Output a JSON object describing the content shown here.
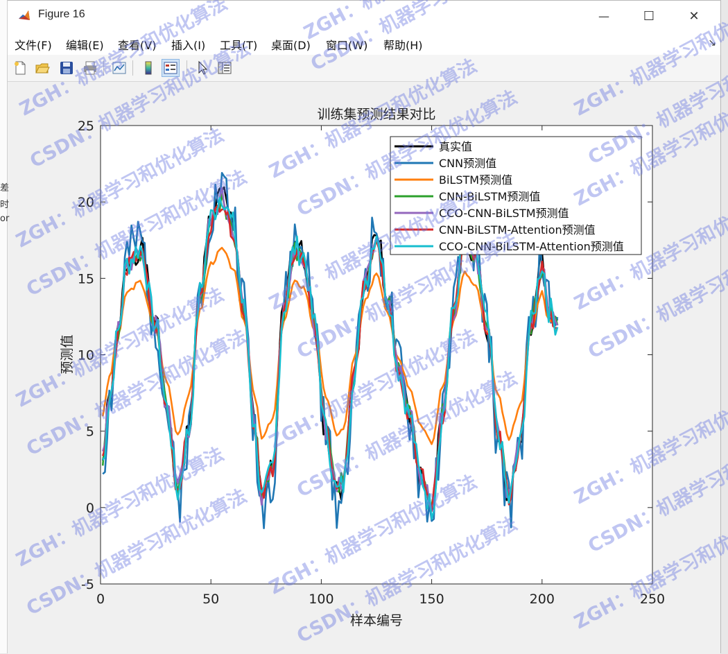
{
  "window": {
    "title": "Figure 16",
    "minimize_label": "—",
    "maximize_label": "☐",
    "close_label": "✕"
  },
  "menu": {
    "items": [
      {
        "label": "文件(F)"
      },
      {
        "label": "编辑(E)"
      },
      {
        "label": "查看(V)"
      },
      {
        "label": "插入(I)"
      },
      {
        "label": "工具(T)"
      },
      {
        "label": "桌面(D)"
      },
      {
        "label": "窗口(W)"
      },
      {
        "label": "帮助(H)"
      }
    ],
    "overflow_arrow": "↘"
  },
  "toolbar": {
    "buttons": [
      {
        "name": "new-figure-icon"
      },
      {
        "name": "open-file-icon"
      },
      {
        "name": "save-icon"
      },
      {
        "name": "print-icon"
      },
      {
        "name": "link-plot-icon"
      },
      {
        "name": "insert-colorbar-icon"
      },
      {
        "name": "insert-legend-icon"
      },
      {
        "name": "pointer-icon"
      },
      {
        "name": "property-inspector-icon"
      }
    ]
  },
  "left_fragments": [
    "差",
    "时",
    "or"
  ],
  "watermark_texts": [
    "ZGH：机器学习和优化算法",
    "CSDN：机器学习和优化算法"
  ],
  "chart_data": {
    "type": "line",
    "title": "训练集预测结果对比",
    "xlabel": "样本编号",
    "ylabel": "预测值",
    "xlim": [
      0,
      250
    ],
    "ylim": [
      -5,
      25
    ],
    "xticks": [
      0,
      50,
      100,
      150,
      200,
      250
    ],
    "yticks": [
      -5,
      0,
      5,
      10,
      15,
      20,
      25
    ],
    "legend_position": "top-right",
    "series": [
      {
        "name": "真实值",
        "color": "#000000",
        "width": 2.6,
        "seed": 1,
        "noise": 0.9,
        "amp": 1.0,
        "off": 0.0
      },
      {
        "name": "CNN预测值",
        "color": "#1f77b4",
        "width": 2.6,
        "seed": 2,
        "noise": 1.9,
        "amp": 1.05,
        "off": 0.0
      },
      {
        "name": "BiLSTM预测值",
        "color": "#ff7f0e",
        "width": 2.6,
        "seed": 3,
        "noise": 0.15,
        "amp": 0.62,
        "off": 0.4
      },
      {
        "name": "CNN-BiLSTM预测值",
        "color": "#2ca02c",
        "width": 2.6,
        "seed": 4,
        "noise": 0.6,
        "amp": 0.96,
        "off": 0.0
      },
      {
        "name": "CCO-CNN-BiLSTM预测值",
        "color": "#9467bd",
        "width": 2.6,
        "seed": 5,
        "noise": 0.7,
        "amp": 0.98,
        "off": 0.0
      },
      {
        "name": "CNN-BiLSTM-Attention预测值",
        "color": "#d62728",
        "width": 2.6,
        "seed": 6,
        "noise": 0.6,
        "amp": 0.97,
        "off": -0.1
      },
      {
        "name": "CCO-CNN-BiLSTM-Attention预测值",
        "color": "#17becf",
        "width": 2.6,
        "seed": 7,
        "noise": 0.9,
        "amp": 1.0,
        "off": 0.0
      }
    ],
    "base_curve": {
      "x": [
        1,
        4,
        8,
        12,
        18,
        25,
        30,
        35,
        40,
        45,
        50,
        55,
        60,
        65,
        70,
        73,
        78,
        83,
        88,
        92,
        97,
        102,
        107,
        110,
        115,
        120,
        125,
        130,
        135,
        140,
        145,
        150,
        155,
        160,
        165,
        170,
        175,
        180,
        185,
        190,
        195,
        200,
        203,
        207
      ],
      "y": [
        3.0,
        7.0,
        11.5,
        16.0,
        17.0,
        12.0,
        6.5,
        1.0,
        5.0,
        14.0,
        19.0,
        20.5,
        18.5,
        13.0,
        5.0,
        0.5,
        2.5,
        13.0,
        17.0,
        16.5,
        12.0,
        5.0,
        1.0,
        1.5,
        9.0,
        15.0,
        18.0,
        14.0,
        9.0,
        6.0,
        2.0,
        0.0,
        6.0,
        13.0,
        18.0,
        16.5,
        12.0,
        5.0,
        0.5,
        4.0,
        12.0,
        16.0,
        13.0,
        12.0
      ]
    }
  }
}
